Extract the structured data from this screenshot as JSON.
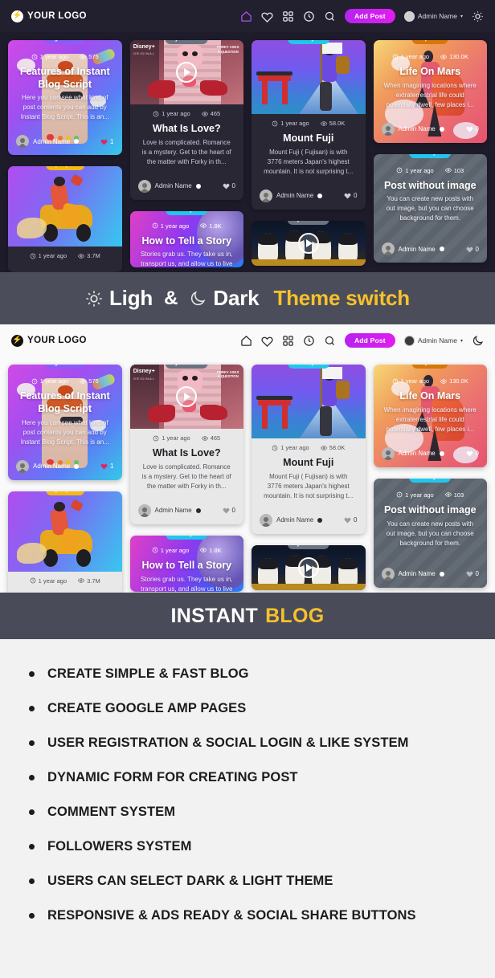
{
  "brand": {
    "logo_text": "YOUR LOGO",
    "logo_icon": "bolt-icon"
  },
  "navbar": {
    "icons": [
      "home-icon",
      "heart-icon",
      "grid-icon",
      "clock-icon",
      "search-icon"
    ],
    "add_post_label": "Add Post",
    "user_name": "Admin Name",
    "caret": "▾",
    "dark_theme_toggle_icon": "sun-icon",
    "light_theme_toggle_icon": "moon-icon"
  },
  "switch_banner": {
    "sun_icon": "sun-icon",
    "light_label": "Ligh",
    "amp": "&",
    "moon_icon": "moon-icon",
    "dark_label": "Dark",
    "accent_label": "Theme switch",
    "accent_color": "#f7c12b",
    "background": "#4b4e5a"
  },
  "title_banner": {
    "primary": "INSTANT",
    "accent": "BLOG",
    "accent_color": "#f7c12b",
    "background": "#494c58"
  },
  "features": {
    "items": [
      "CREATE SIMPLE & FAST BLOG",
      "CREATE GOOGLE AMP PAGES",
      "USER REGISTRATION & SOCIAL LOGIN & LIKE SYSTEM",
      "DYNAMIC FORM FOR CREATING POST",
      "COMMENT SYSTEM",
      "FOLLOWERS SYSTEM",
      "USERS CAN SELECT DARK & LIGHT THEME",
      "RESPONSIVE & ADS READY & SOCIAL SHARE BUTTONS"
    ]
  },
  "posts": {
    "features_post": {
      "tag": "general",
      "tag_color": "#8b5cf6",
      "time": "1 year ago",
      "views": "575",
      "title": "Features of Instant Blog Script",
      "excerpt": "Here you can see what kind of post contents you can add by Instant Blog Script. This is an...",
      "author": "Admin Name",
      "likes": "1"
    },
    "scooter_post": {
      "tag": "people",
      "tag_color": "#f5b914",
      "time": "1 year ago",
      "views": "3.7M"
    },
    "what_is_love": {
      "tag": "youtube",
      "tag_color": "#6b7280",
      "time": "1 year ago",
      "views": "465",
      "title": "What Is Love?",
      "excerpt": "Love is complicated. Romance is a mystery. Get to the heart of the matter with Forky in th...",
      "author": "Admin Name",
      "likes": "0",
      "thumb_brand": "Disney+",
      "thumb_sub": "ORIGINAL",
      "thumb_corner": "FORKY ASKS A QUESTION"
    },
    "how_to_tell_story": {
      "tag": "lifestyle",
      "tag_color": "#22c6ec",
      "time": "1 year ago",
      "views": "1.8K",
      "title": "How to Tell a Story",
      "excerpt": "Stories grab us. They take us in, transport us, and allow us to live"
    },
    "mount_fuji": {
      "tag": "lifestyle",
      "tag_color": "#22c6ec",
      "time": "1 year ago",
      "views": "58.0K",
      "title": "Mount Fuji",
      "excerpt": "Mount Fuji ( Fujisan) is with 3776 meters Japan's highest mountain. It is not surprising t...",
      "author": "Admin Name",
      "likes": "0"
    },
    "penguins_post": {
      "tag": "youtube",
      "tag_color": "#6b7280"
    },
    "life_on_mars": {
      "tag": "space",
      "tag_color": "#d97706",
      "time": "1 year ago",
      "views": "130.0K",
      "title": "Life On Mars",
      "excerpt": "When imagining locations where extraterrestrial life could potentially dwell, few places i...",
      "author": "Admin Name",
      "likes": "0"
    },
    "post_without_image": {
      "tag": "lifestyle",
      "tag_color": "#22c6ec",
      "time": "1 year ago",
      "views": "103",
      "title": "Post without image",
      "excerpt": "You can create new posts with out image, but you can choose background for them.",
      "author": "Admin Name",
      "likes": "0"
    }
  }
}
